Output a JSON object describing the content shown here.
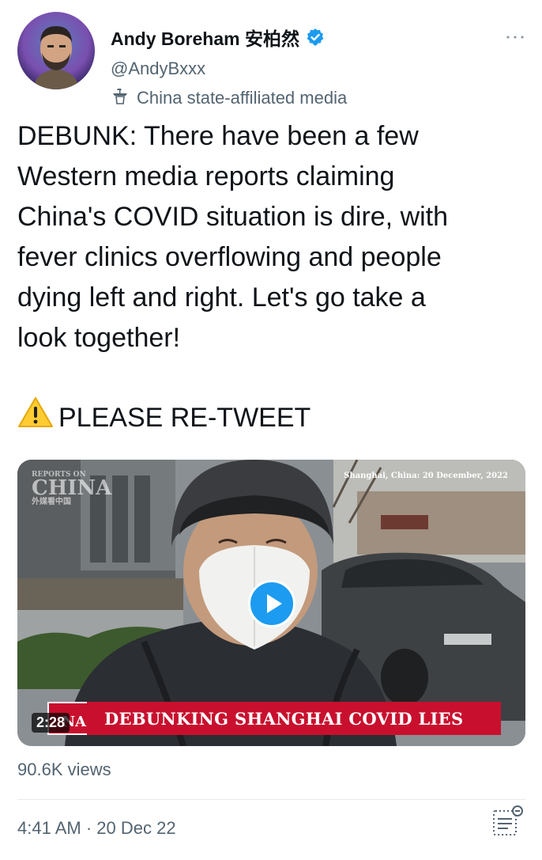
{
  "author": {
    "display_name": "Andy Boreham 安柏然",
    "handle": "@AndyBxxx",
    "label": "China state-affiliated media",
    "verified_color": "#1d9bf0"
  },
  "tweet": {
    "text": "DEBUNK: There have been a few\nWestern media reports claiming\nChina's COVID situation is dire, with\nfever clinics overflowing and people\ndying left and right. Let's go take a\nlook together!",
    "retweet_emoji": "⚠️",
    "retweet_text": "PLEASE RE-TWEET"
  },
  "video": {
    "duration": "2:28",
    "caption": "DEBUNKING SHANGHAI COVID LIES",
    "date_overlay": "Shanghai, China: 20 December, 2022",
    "channel_logo_top": "REPORTS ON",
    "channel_logo_main": "CHINA",
    "channel_logo_sub": "外媒看中国",
    "caption_logo_text": "NA",
    "accent_color": "#c8102e"
  },
  "stats": {
    "views": "90.6K views",
    "timestamp": "4:41 AM · 20 Dec 22"
  }
}
